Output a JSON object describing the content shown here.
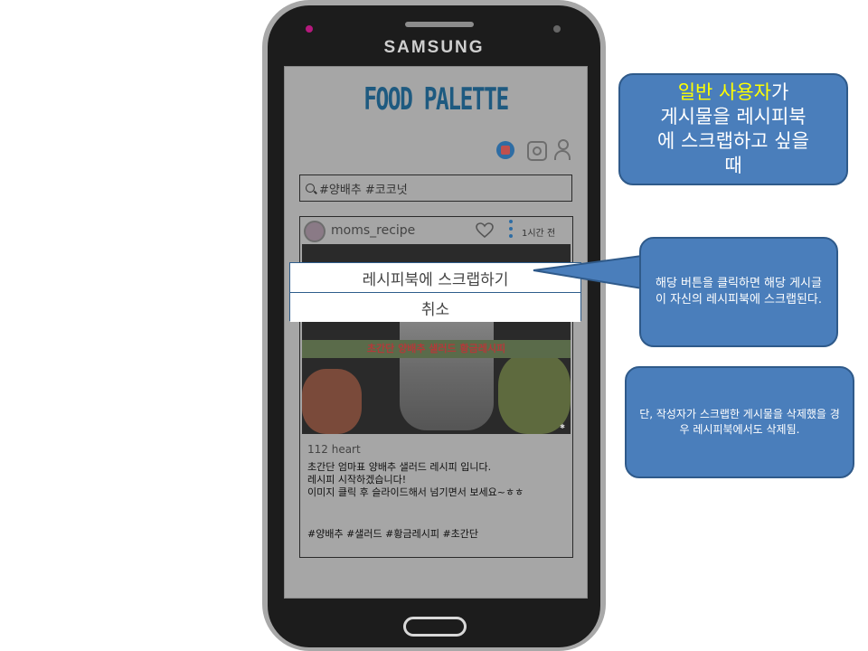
{
  "phone": {
    "brand": "SAMSUNG"
  },
  "app": {
    "title": "FOOD PALETTE",
    "icons": [
      "recipe-book-icon",
      "instagram-icon",
      "person-icon"
    ]
  },
  "search": {
    "query": "#양배추 #코코넛",
    "icon": "search-icon"
  },
  "post": {
    "author": "moms_recipe",
    "time": "1시간 전",
    "image_banner": "초간단 양배추 샐러드 황금레시피",
    "likes": "112  heart",
    "caption": "초간단 엄마표 양배추 샐러드 레시피 입니다.\n레시피 시작하겠습니다!\n이미지 클릭 후 슬라이드해서 넘기면서 보세요~ㅎㅎ",
    "hashtags": "#양배추 #샐러드 #황금레시피 #초간단"
  },
  "menu": {
    "scrap": "레시피북에 스크랩하기",
    "cancel": "취소"
  },
  "callouts": {
    "scenario_highlight": "일반 사용자",
    "scenario_line1_rest": "가",
    "scenario_rest": "게시물을 레시피북\n에 스크랩하고 싶을\n때",
    "explain": "해당 버튼을 클릭하면 해당 게시글이 자신의 레시피북에 스크랩된다.",
    "note": "단, 작성자가 스크랩한 게시물을 삭제했을 경우 레시피북에서도 삭제됨."
  },
  "colors": {
    "callout_fill": "#4a7ebb",
    "callout_highlight": "#ffff00",
    "title": "#1e5a80",
    "screen_overlay": "#a6a6a6"
  }
}
